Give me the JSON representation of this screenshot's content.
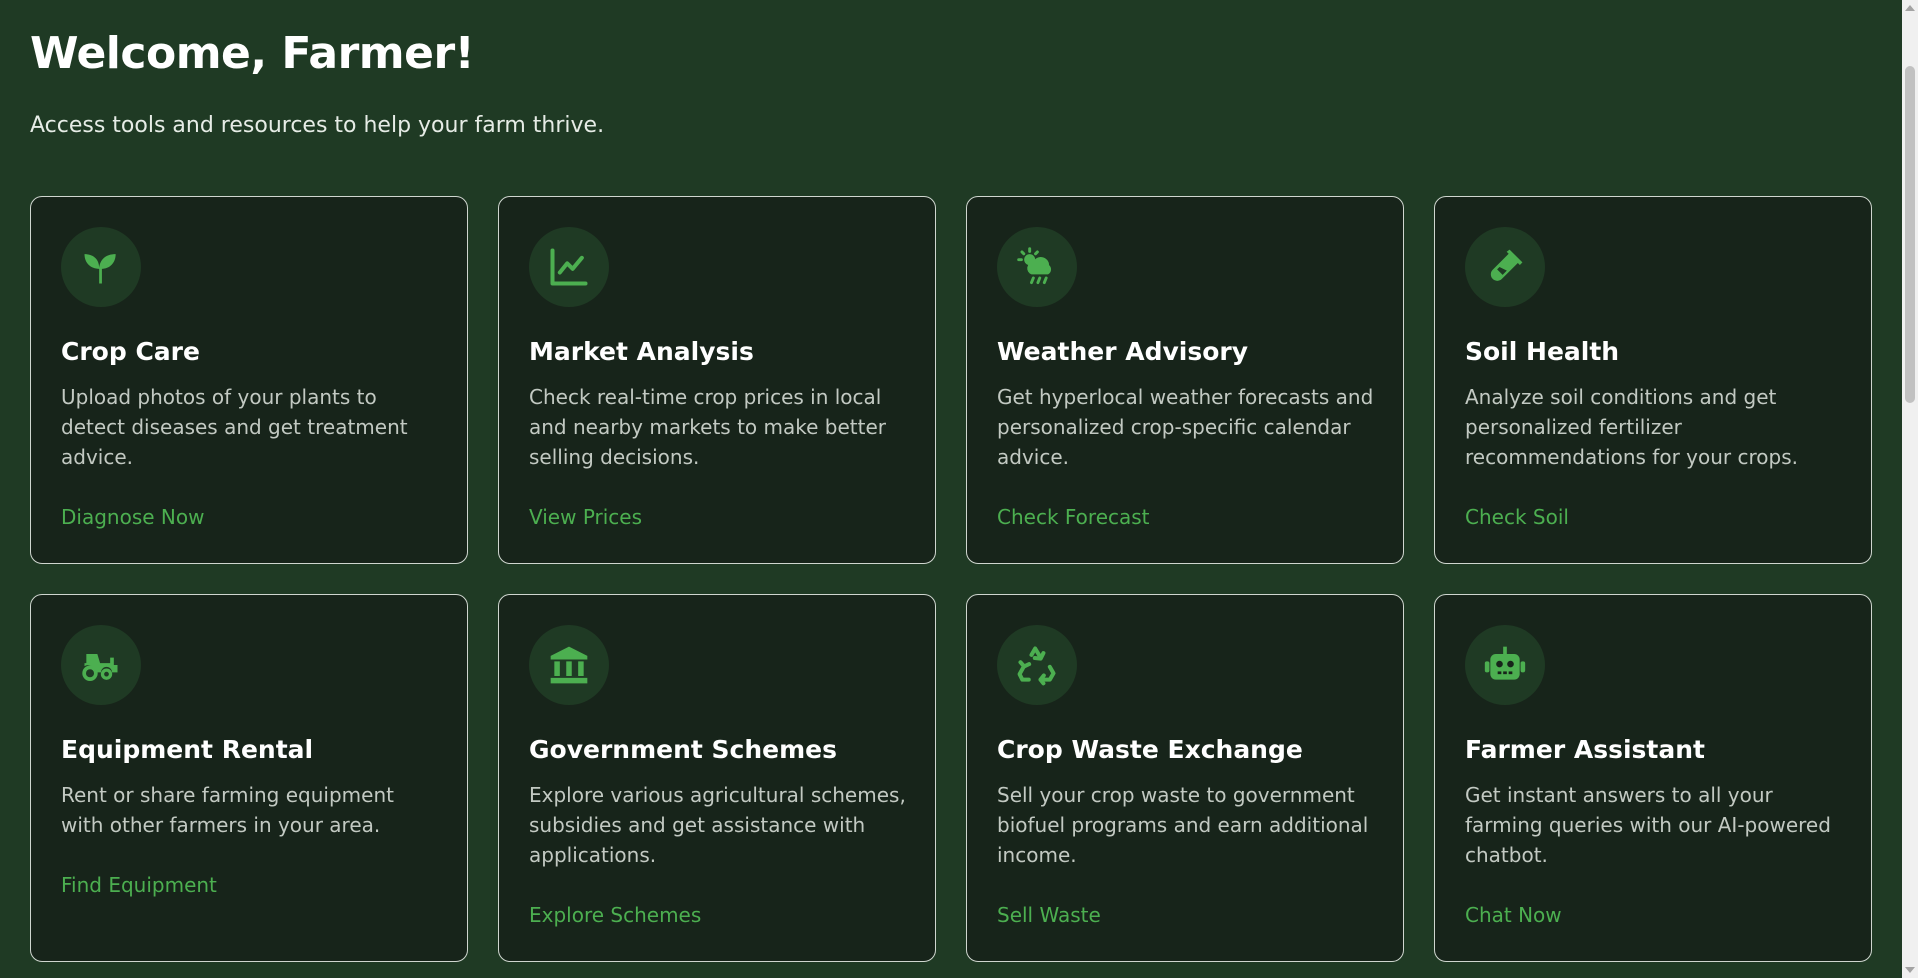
{
  "header": {
    "title": "Welcome, Farmer!",
    "subtitle": "Access tools and resources to help your farm thrive."
  },
  "colors": {
    "background": "#1f3a24",
    "card": "#17241a",
    "accent": "#4caf50"
  },
  "cards": [
    {
      "icon": "seedling-icon",
      "title": "Crop Care",
      "description": "Upload photos of your plants to detect diseases and get treatment advice.",
      "link": "Diagnose Now"
    },
    {
      "icon": "chart-line-icon",
      "title": "Market Analysis",
      "description": "Check real-time crop prices in local and nearby markets to make better selling decisions.",
      "link": "View Prices"
    },
    {
      "icon": "weather-icon",
      "title": "Weather Advisory",
      "description": "Get hyperlocal weather forecasts and personalized crop-specific calendar advice.",
      "link": "Check Forecast"
    },
    {
      "icon": "test-tube-icon",
      "title": "Soil Health",
      "description": "Analyze soil conditions and get personalized fertilizer recommendations for your crops.",
      "link": "Check Soil"
    },
    {
      "icon": "tractor-icon",
      "title": "Equipment Rental",
      "description": "Rent or share farming equipment with other farmers in your area.",
      "link": "Find Equipment"
    },
    {
      "icon": "bank-icon",
      "title": "Government Schemes",
      "description": "Explore various agricultural schemes, subsidies and get assistance with applications.",
      "link": "Explore Schemes"
    },
    {
      "icon": "recycle-icon",
      "title": "Crop Waste Exchange",
      "description": "Sell your crop waste to government biofuel programs and earn additional income.",
      "link": "Sell Waste"
    },
    {
      "icon": "robot-icon",
      "title": "Farmer Assistant",
      "description": "Get instant answers to all your farming queries with our AI-powered chatbot.",
      "link": "Chat Now"
    }
  ]
}
